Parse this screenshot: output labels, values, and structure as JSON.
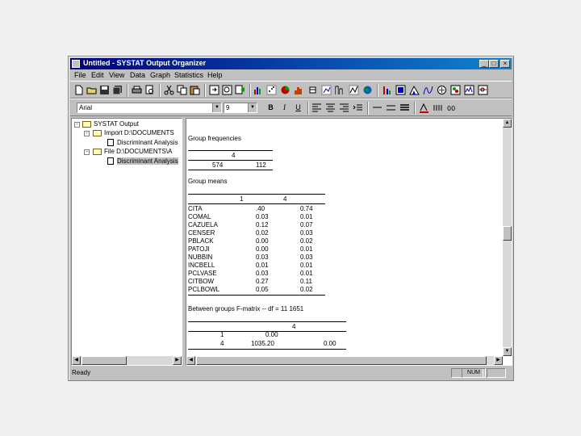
{
  "window": {
    "title": "Untitled - SYSTAT Output Organizer",
    "minimize": "_",
    "maximize": "□",
    "close": "×"
  },
  "menu": [
    "File",
    "Edit",
    "View",
    "Data",
    "Graph",
    "Statistics",
    "Help"
  ],
  "toolbar2": {
    "font": "Arial",
    "size": "9",
    "bold": "B",
    "italic": "I",
    "underline": "U"
  },
  "tree": {
    "root": "SYSTAT Output",
    "import_node": "Import D:\\DOCUMENTS",
    "import_child": "Discriminant Analysis",
    "file_node": "File D:\\DOCUMENTS\\A",
    "file_child": "Discriminant Analysis"
  },
  "output": {
    "freq_title": "Group frequencies",
    "freq_header": "4",
    "freq_values": [
      "574",
      "112"
    ],
    "means_title": "Group means",
    "means_header_1": "1",
    "means_header_2": "4",
    "means_rows": [
      {
        "name": "CITA",
        "v1": ".40",
        "v2": "0.74"
      },
      {
        "name": "COMAL",
        "v1": "0.03",
        "v2": "0.01"
      },
      {
        "name": "CAZUELA",
        "v1": "0.12",
        "v2": "0.07"
      },
      {
        "name": "CENSER",
        "v1": "0.02",
        "v2": "0.03"
      },
      {
        "name": "PBLACK",
        "v1": "0.00",
        "v2": "0.02"
      },
      {
        "name": "PATOJI",
        "v1": "0.00",
        "v2": "0.01"
      },
      {
        "name": "NUBBIN",
        "v1": "0.03",
        "v2": "0.03"
      },
      {
        "name": "INCBELL",
        "v1": "0.01",
        "v2": "0.01"
      },
      {
        "name": "PCLVASE",
        "v1": "0.03",
        "v2": "0.01"
      },
      {
        "name": "CITBOW",
        "v1": "0.27",
        "v2": "0.11"
      },
      {
        "name": "PCLBOWL",
        "v1": "0.05",
        "v2": "0.02"
      }
    ],
    "f_title": "Between groups F-matrix -- df = 11 1651",
    "f_header": "4",
    "f_rows": [
      {
        "label": "1",
        "v1": "0.00",
        "v2": ""
      },
      {
        "label": "4",
        "v1": "1035.20",
        "v2": "0.00"
      }
    ]
  },
  "status": {
    "text": "Ready",
    "num": "NUM"
  }
}
